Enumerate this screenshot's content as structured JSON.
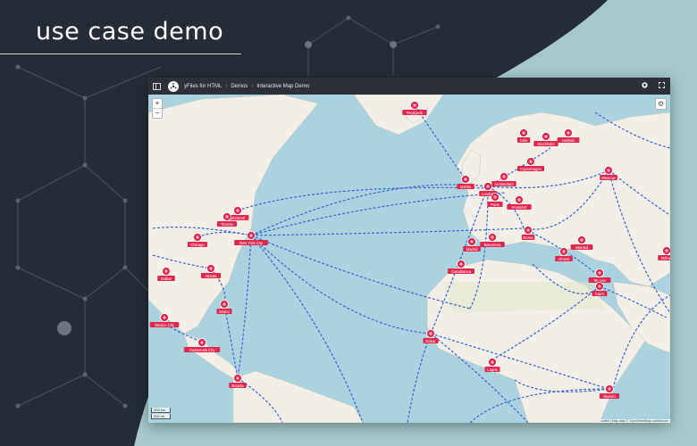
{
  "headline": "use case demo",
  "colors": {
    "background": "#262c36",
    "accent_shape": "#a6c8cb",
    "ocean": "#aad3df",
    "land": "#f2efe9",
    "route": "#3a62d6",
    "marker": "#e0274e"
  },
  "toolbar": {
    "menu_icon": "panel-toggle-icon",
    "logo_icon": "yfiles-logo-icon",
    "breadcrumb": [
      "yFiles for HTML",
      "Demos",
      "Interactive Map Demo"
    ],
    "github_icon": "github-icon",
    "fullscreen_icon": "fullscreen-icon"
  },
  "map": {
    "zoom_in": "+",
    "zoom_out": "−",
    "overview_icon": "gear-icon",
    "scale": [
      "300 km",
      "200 mi"
    ],
    "attribution": "Leaflet | Map data © OpenStreetMap contributors"
  },
  "cities": [
    "Reykjavik",
    "Oslo",
    "Stockholm",
    "Helsinki",
    "Copenhagen",
    "Moscow",
    "Dublin",
    "London",
    "Amsterdam",
    "Paris",
    "Frankfurt",
    "Montreal",
    "Toronto",
    "Chicago",
    "New York City",
    "Atlanta",
    "Dallas",
    "Miami",
    "Mexico City",
    "Guatemala City",
    "Bogota",
    "Madrid",
    "Barcelona",
    "Rome",
    "Athens",
    "Istanbul",
    "Tel Aviv",
    "Cairo",
    "Casablanca",
    "Dakar",
    "Lagos",
    "Nairobi",
    "Tehran"
  ]
}
